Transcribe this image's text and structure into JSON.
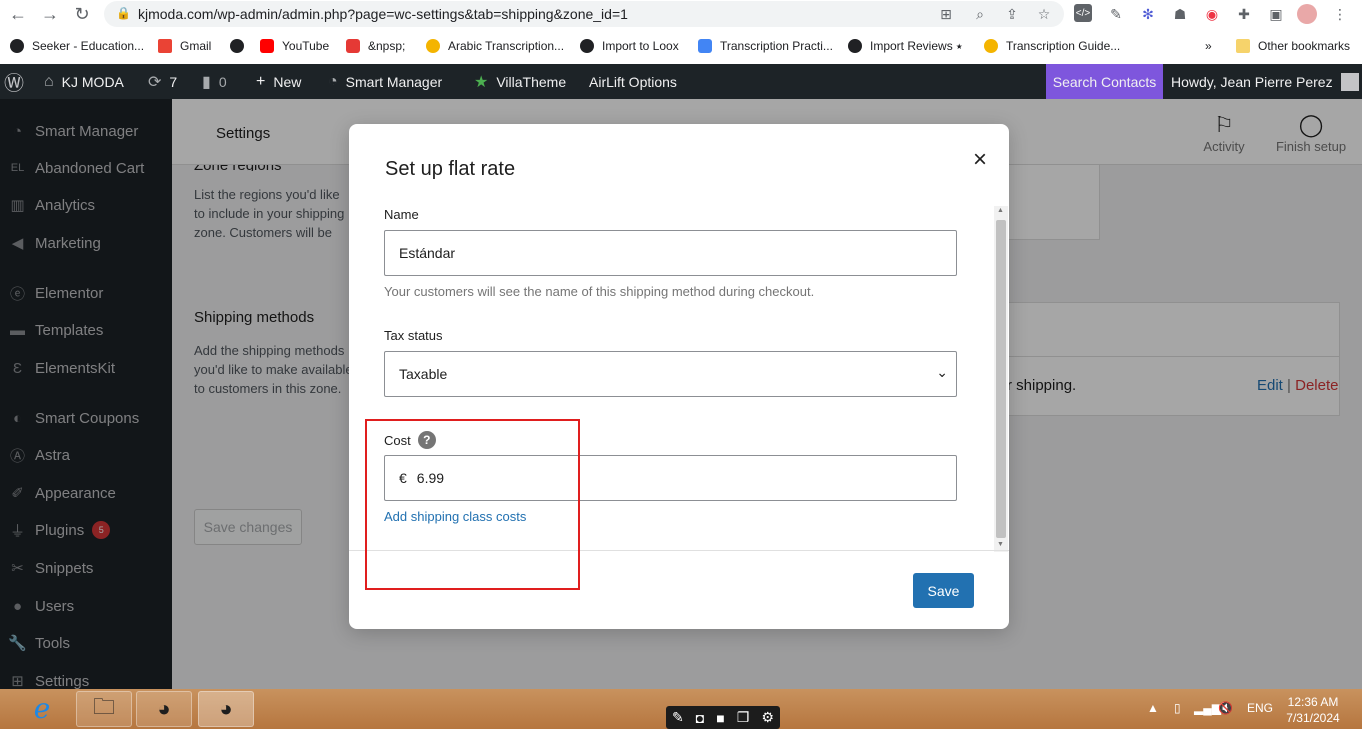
{
  "browser": {
    "url": "kjmoda.com/wp-admin/admin.php?page=wc-settings&tab=shipping&zone_id=1",
    "bookmarks": [
      "Seeker - Education...",
      "Gmail",
      "&npsp;",
      "YouTube",
      "&npsp;",
      "Arabic Transcription...",
      "Import to Loox",
      "Transcription Practi...",
      "Import Reviews ⭑",
      "Transcription Guide..."
    ],
    "overflow": "»",
    "other_bookmarks": "Other bookmarks"
  },
  "adminbar": {
    "site_name": "KJ MODA",
    "updates_count": "7",
    "comments_count": "0",
    "new_label": "New",
    "smart_manager": "Smart Manager",
    "villatheme": "VillaTheme",
    "airlift": "AirLift Options",
    "search_contacts": "Search Contacts",
    "howdy": "Howdy, Jean Pierre Perez"
  },
  "sidebar": {
    "items": [
      {
        "label": "Smart Manager",
        "icon": "gauge-icon"
      },
      {
        "label": "Abandoned Cart",
        "icon": "elex-icon"
      },
      {
        "label": "Analytics",
        "icon": "bar-chart-icon"
      },
      {
        "label": "Marketing",
        "icon": "megaphone-icon"
      },
      {
        "label": "Elementor",
        "icon": "elementor-icon"
      },
      {
        "label": "Templates",
        "icon": "folder-icon"
      },
      {
        "label": "ElementsKit",
        "icon": "ek-icon"
      },
      {
        "label": "Smart Coupons",
        "icon": "coupon-icon"
      },
      {
        "label": "Astra",
        "icon": "astra-icon"
      },
      {
        "label": "Appearance",
        "icon": "brush-icon"
      },
      {
        "label": "Plugins",
        "icon": "plug-icon"
      },
      {
        "label": "Snippets",
        "icon": "scissors-icon"
      },
      {
        "label": "Users",
        "icon": "user-icon"
      },
      {
        "label": "Tools",
        "icon": "wrench-icon"
      },
      {
        "label": "Settings",
        "icon": "settings-icon"
      }
    ],
    "plugins_badge": "5"
  },
  "page": {
    "settings_title": "Settings",
    "activity": "Activity",
    "finish_setup": "Finish setup",
    "zone_regions_title": "Zone regions",
    "zone_regions_desc": "List the regions you'd like to include in your shipping zone. Customers will be matched against these regions.",
    "shipping_methods_title": "Shipping methods",
    "shipping_methods_desc": "Add the shipping methods you'd like to make available to customers in this zone.",
    "save_changes": "Save changes",
    "row_text": "r shipping.",
    "edit": "Edit",
    "sep": "|",
    "delete": "Delete"
  },
  "modal": {
    "title": "Set up flat rate",
    "close": "×",
    "name_label": "Name",
    "name_value": "Estándar",
    "name_help": "Your customers will see the name of this shipping method during checkout.",
    "tax_label": "Tax status",
    "tax_value": "Taxable",
    "cost_label": "Cost",
    "currency": "€",
    "cost_value": "6.99",
    "add_class_costs": "Add shipping class costs",
    "save": "Save"
  },
  "taskbar": {
    "lang": "ENG",
    "time": "12:36 AM",
    "date": "7/31/2024"
  },
  "colors": {
    "admin_dark": "#1d2327",
    "accent_blue": "#2271b1",
    "search_purple": "#7e56dd",
    "highlight_red": "#e01e1e"
  }
}
